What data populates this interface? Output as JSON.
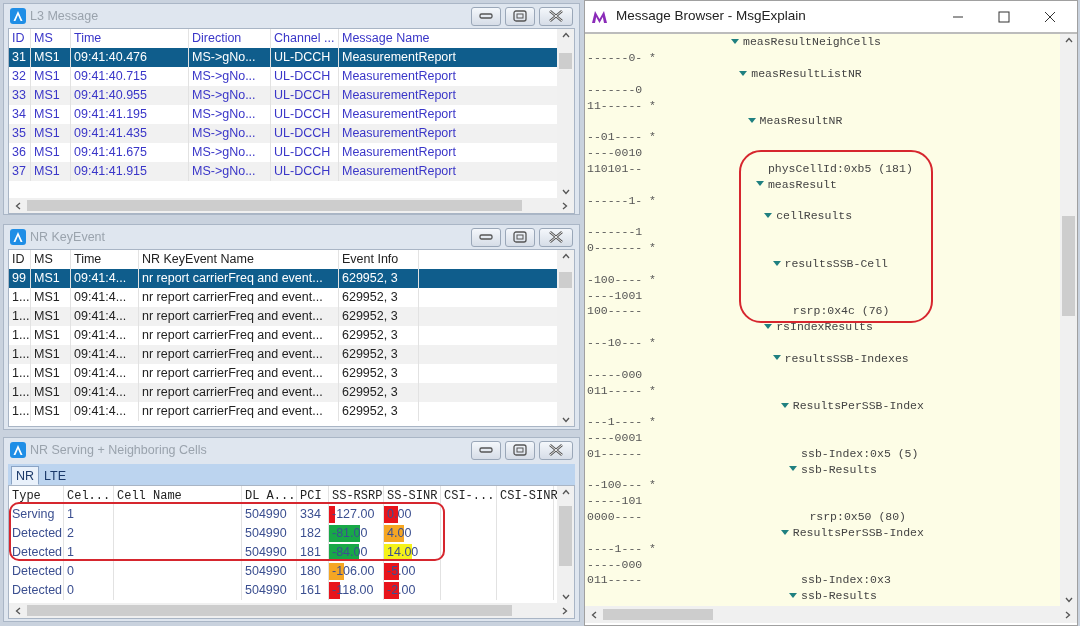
{
  "l3_message": {
    "title": "L3 Message",
    "columns": [
      "ID",
      "MS",
      "Time",
      "Direction",
      "Channel ...",
      "Message Name"
    ],
    "rows": [
      {
        "cells": [
          "31",
          "MS1",
          "09:41:40.476",
          "MS->gNo...",
          "UL-DCCH",
          "MeasurementReport"
        ],
        "selected": true
      },
      {
        "cells": [
          "32",
          "MS1",
          "09:41:40.715",
          "MS->gNo...",
          "UL-DCCH",
          "MeasurementReport"
        ],
        "selected": false
      },
      {
        "cells": [
          "33",
          "MS1",
          "09:41:40.955",
          "MS->gNo...",
          "UL-DCCH",
          "MeasurementReport"
        ],
        "selected": false
      },
      {
        "cells": [
          "34",
          "MS1",
          "09:41:41.195",
          "MS->gNo...",
          "UL-DCCH",
          "MeasurementReport"
        ],
        "selected": false
      },
      {
        "cells": [
          "35",
          "MS1",
          "09:41:41.435",
          "MS->gNo...",
          "UL-DCCH",
          "MeasurementReport"
        ],
        "selected": false
      },
      {
        "cells": [
          "36",
          "MS1",
          "09:41:41.675",
          "MS->gNo...",
          "UL-DCCH",
          "MeasurementReport"
        ],
        "selected": false
      },
      {
        "cells": [
          "37",
          "MS1",
          "09:41:41.915",
          "MS->gNo...",
          "UL-DCCH",
          "MeasurementReport"
        ],
        "selected": false
      }
    ]
  },
  "nr_key_event": {
    "title": "NR KeyEvent",
    "columns": [
      "ID",
      "MS",
      "Time",
      "NR KeyEvent Name",
      "Event Info"
    ],
    "rows": [
      {
        "cells": [
          "99",
          "MS1",
          "09:41:4...",
          "nr report carrierFreq and event...",
          "629952, 3"
        ],
        "selected": true
      },
      {
        "cells": [
          "1...",
          "MS1",
          "09:41:4...",
          "nr report carrierFreq and event...",
          "629952, 3"
        ],
        "selected": false
      },
      {
        "cells": [
          "1...",
          "MS1",
          "09:41:4...",
          "nr report carrierFreq and event...",
          "629952, 3"
        ],
        "selected": false
      },
      {
        "cells": [
          "1...",
          "MS1",
          "09:41:4...",
          "nr report carrierFreq and event...",
          "629952, 3"
        ],
        "selected": false
      },
      {
        "cells": [
          "1...",
          "MS1",
          "09:41:4...",
          "nr report carrierFreq and event...",
          "629952, 3"
        ],
        "selected": false
      },
      {
        "cells": [
          "1...",
          "MS1",
          "09:41:4...",
          "nr report carrierFreq and event...",
          "629952, 3"
        ],
        "selected": false
      },
      {
        "cells": [
          "1...",
          "MS1",
          "09:41:4...",
          "nr report carrierFreq and event...",
          "629952, 3"
        ],
        "selected": false
      },
      {
        "cells": [
          "1...",
          "MS1",
          "09:41:4...",
          "nr report carrierFreq and event...",
          "629952, 3"
        ],
        "selected": false
      }
    ]
  },
  "nr_cells": {
    "title": "NR Serving + Neighboring Cells",
    "tabs": [
      {
        "label": "NR",
        "selected": true
      },
      {
        "label": "LTE",
        "selected": false
      }
    ],
    "columns": [
      "Type",
      "Cel...",
      "Cell Name",
      "DL A...",
      "PCI",
      "SS-RSRP",
      "SS-SINR",
      "CSI-...",
      "CSI-SINR"
    ],
    "rows": [
      {
        "type": "Serving",
        "column_2": "1",
        "column_4": "504990",
        "pci": "334",
        "ss_rsrp": {
          "text": "-127.00",
          "level": 0.12,
          "color": "#e8141c"
        },
        "ss_sinr": {
          "text": "0.00",
          "level": 0.25,
          "color": "#e8141c"
        }
      },
      {
        "type": "Detected",
        "column_2": "2",
        "column_4": "504990",
        "pci": "182",
        "ss_rsrp": {
          "text": "-81.00",
          "level": 0.58,
          "color": "#18a848"
        },
        "ss_sinr": {
          "text": "4.00",
          "level": 0.36,
          "color": "#f5a623"
        }
      },
      {
        "type": "Detected",
        "column_2": "1",
        "column_4": "504990",
        "pci": "181",
        "ss_rsrp": {
          "text": "-84.00",
          "level": 0.56,
          "color": "#18a848"
        },
        "ss_sinr": {
          "text": "14.00",
          "level": 0.5,
          "color": "#f5f21a"
        }
      },
      {
        "type": "Detected",
        "column_2": "0",
        "column_4": "504990",
        "pci": "180",
        "ss_rsrp": {
          "text": "-106.00",
          "level": 0.27,
          "color": "#f5a623"
        },
        "ss_sinr": {
          "text": "-5.00",
          "level": 0.26,
          "color": "#e8141c"
        }
      },
      {
        "type": "Detected",
        "column_2": "0",
        "column_4": "504990",
        "pci": "161",
        "ss_rsrp": {
          "text": "-118.00",
          "level": 0.2,
          "color": "#e8141c"
        },
        "ss_sinr": {
          "text": "-2.00",
          "level": 0.27,
          "color": "#e8141c"
        }
      }
    ]
  },
  "message_browser": {
    "title": "Message Browser - MsgExplain",
    "tree": [
      {
        "kind": "node",
        "label": "measResultNeighCells",
        "expanded": true,
        "children": [
          {
            "kind": "node",
            "label": "measResultListNR",
            "expanded": true,
            "bits_before": [
              "------0- *"
            ],
            "children": [
              {
                "kind": "node",
                "label": "MeasResultNR",
                "expanded": true,
                "bits_before": [
                  "-------0",
                  "11------ *"
                ],
                "children": [
                  {
                    "kind": "value",
                    "label": "physCellId:0xb5 (181)",
                    "bits_before": [
                      "--01---- *",
                      "----0010"
                    ],
                    "bits": "110101--"
                  },
                  {
                    "kind": "node",
                    "label": "measResult",
                    "expanded": true,
                    "children": [
                      {
                        "kind": "node",
                        "label": "cellResults",
                        "expanded": true,
                        "bits_before": [
                          "------1- *"
                        ],
                        "children": [
                          {
                            "kind": "node",
                            "label": "resultsSSB-Cell",
                            "expanded": true,
                            "bits_before": [
                              "-------1",
                              "0------- *"
                            ],
                            "children": [
                              {
                                "kind": "value",
                                "label": "rsrp:0x4c (76)",
                                "bits_before": [
                                  "-100---- *",
                                  "----1001"
                                ],
                                "bits": "100-----"
                              }
                            ]
                          }
                        ]
                      },
                      {
                        "kind": "node",
                        "label": "rsIndexResults",
                        "expanded": true,
                        "children": [
                          {
                            "kind": "node",
                            "label": "resultsSSB-Indexes",
                            "expanded": true,
                            "bits_before": [
                              "---10--- *"
                            ],
                            "children": [
                              {
                                "kind": "node",
                                "label": "ResultsPerSSB-Index",
                                "expanded": true,
                                "bits_before": [
                                  "-----000",
                                  "011----- *"
                                ],
                                "children": [
                                  {
                                    "kind": "value",
                                    "label": "ssb-Index:0x5 (5)",
                                    "bits_before": [
                                      "---1---- *",
                                      "----0001"
                                    ],
                                    "bits": "01------"
                                  },
                                  {
                                    "kind": "node",
                                    "label": "ssb-Results",
                                    "expanded": true,
                                    "children": [
                                      {
                                        "kind": "value",
                                        "label": "rsrp:0x50 (80)",
                                        "bits_before": [
                                          "--100--- *",
                                          "-----101"
                                        ],
                                        "bits": "0000----"
                                      }
                                    ]
                                  }
                                ]
                              },
                              {
                                "kind": "node",
                                "label": "ResultsPerSSB-Index",
                                "expanded": true,
                                "children": [
                                  {
                                    "kind": "value",
                                    "label": "ssb-Index:0x3",
                                    "bits_before": [
                                      "----1--- *",
                                      "-----000"
                                    ],
                                    "bits": "011-----"
                                  },
                                  {
                                    "kind": "node",
                                    "label": "ssb-Results",
                                    "expanded": true
                                  }
                                ]
                              }
                            ]
                          }
                        ]
                      }
                    ]
                  }
                ]
              }
            ]
          }
        ]
      }
    ]
  }
}
